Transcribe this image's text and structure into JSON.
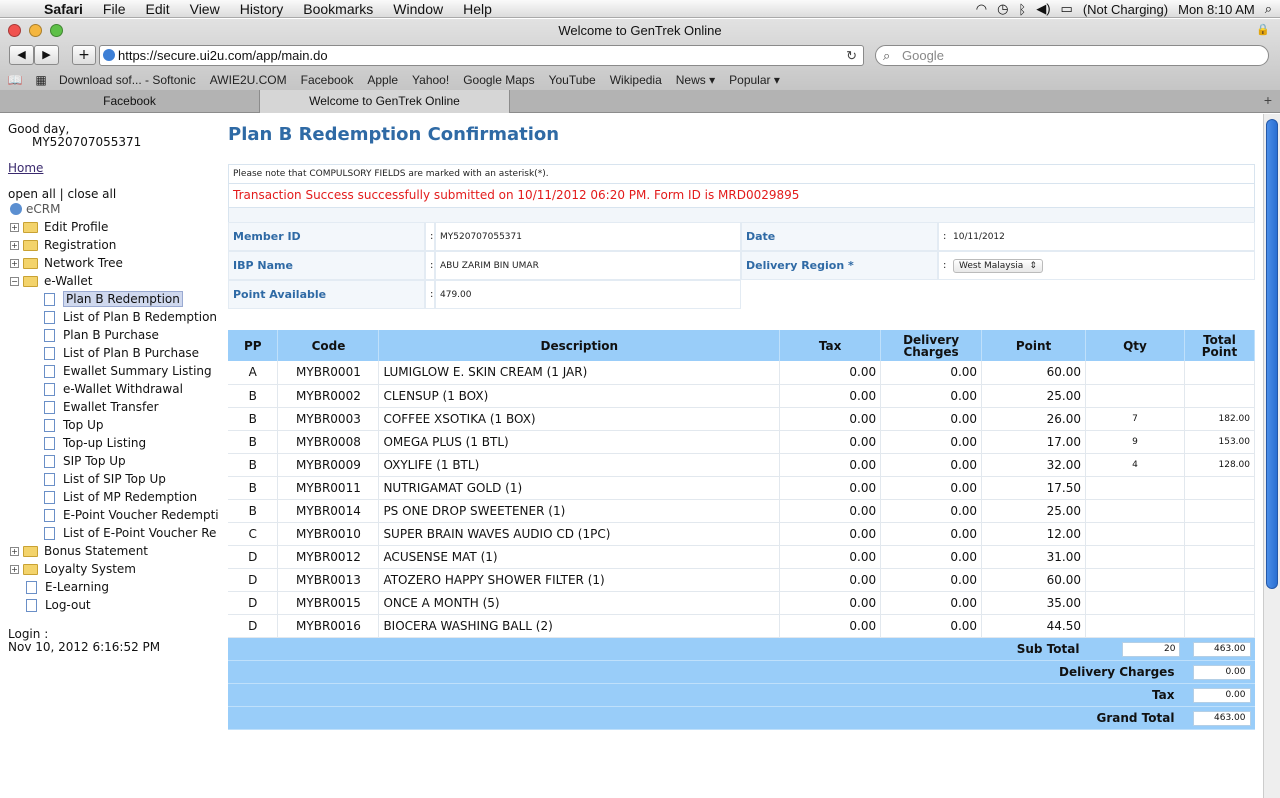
{
  "menubar": {
    "app": "Safari",
    "items": [
      "File",
      "Edit",
      "View",
      "History",
      "Bookmarks",
      "Window",
      "Help"
    ],
    "battery": "(Not Charging)",
    "clock": "Mon 8:10 AM"
  },
  "window": {
    "title": "Welcome to GenTrek Online"
  },
  "toolbar": {
    "url": "https://secure.ui2u.com/app/main.do",
    "search_placeholder": "Google"
  },
  "bookmarks": [
    "Download sof... - Softonic",
    "AWIE2U.COM",
    "Facebook",
    "Apple",
    "Yahoo!",
    "Google Maps",
    "YouTube",
    "Wikipedia",
    "News ▾",
    "Popular ▾"
  ],
  "tabs": [
    {
      "label": "Facebook"
    },
    {
      "label": "Welcome to GenTrek Online"
    }
  ],
  "sidebar": {
    "greeting": "Good day,",
    "user_id": "MY520707055371",
    "home": "Home",
    "open_close": "open all | close all",
    "root": "eCRM",
    "nodes": [
      {
        "label": "Edit Profile",
        "type": "folder"
      },
      {
        "label": "Registration",
        "type": "folder"
      },
      {
        "label": "Network Tree",
        "type": "folder"
      },
      {
        "label": "e-Wallet",
        "type": "folder-open"
      },
      {
        "label": "Plan B Redemption",
        "type": "page",
        "selected": true
      },
      {
        "label": "List of Plan B Redemption",
        "type": "page"
      },
      {
        "label": "Plan B Purchase",
        "type": "page"
      },
      {
        "label": "List of Plan B Purchase",
        "type": "page"
      },
      {
        "label": "Ewallet Summary Listing",
        "type": "page"
      },
      {
        "label": "e-Wallet Withdrawal",
        "type": "page"
      },
      {
        "label": "Ewallet Transfer",
        "type": "page"
      },
      {
        "label": "Top Up",
        "type": "page"
      },
      {
        "label": "Top-up Listing",
        "type": "page"
      },
      {
        "label": "SIP Top Up",
        "type": "page"
      },
      {
        "label": "List of SIP Top Up",
        "type": "page"
      },
      {
        "label": "List of MP Redemption",
        "type": "page"
      },
      {
        "label": "E-Point Voucher Redempti",
        "type": "page"
      },
      {
        "label": "List of E-Point Voucher Re",
        "type": "page"
      },
      {
        "label": "Bonus Statement",
        "type": "folder"
      },
      {
        "label": "Loyalty System",
        "type": "folder"
      },
      {
        "label": "E-Learning",
        "type": "page-root"
      },
      {
        "label": "Log-out",
        "type": "page-root"
      }
    ],
    "login_label": "Login :",
    "login_time": "Nov 10, 2012 6:16:52 PM"
  },
  "main": {
    "title": "Plan B Redemption Confirmation",
    "note": "Please note that COMPULSORY FIELDS are marked with an asterisk(*).",
    "success": "Transaction Success successfully submitted on 10/11/2012 06:20 PM. Form ID is MRD0029895",
    "info": {
      "member_id_label": "Member ID",
      "member_id": "MY520707055371",
      "date_label": "Date",
      "date": "10/11/2012",
      "ibp_label": "IBP Name",
      "ibp": "ABU ZARIM BIN UMAR",
      "region_label": "Delivery Region *",
      "region": "West Malaysia",
      "points_label": "Point Available",
      "points": "479.00",
      "colon": ":"
    },
    "table": {
      "headers": [
        "PP",
        "Code",
        "Description",
        "Tax",
        "Delivery Charges",
        "Point",
        "Qty",
        "Total Point"
      ],
      "rows": [
        [
          "A",
          "MYBR0001",
          "LUMIGLOW E. SKIN CREAM (1 JAR)",
          "0.00",
          "0.00",
          "60.00",
          "",
          ""
        ],
        [
          "B",
          "MYBR0002",
          "CLENSUP (1 BOX)",
          "0.00",
          "0.00",
          "25.00",
          "",
          ""
        ],
        [
          "B",
          "MYBR0003",
          "COFFEE XSOTIKA (1 BOX)",
          "0.00",
          "0.00",
          "26.00",
          "7",
          "182.00"
        ],
        [
          "B",
          "MYBR0008",
          "OMEGA PLUS (1 BTL)",
          "0.00",
          "0.00",
          "17.00",
          "9",
          "153.00"
        ],
        [
          "B",
          "MYBR0009",
          "OXYLIFE (1 BTL)",
          "0.00",
          "0.00",
          "32.00",
          "4",
          "128.00"
        ],
        [
          "B",
          "MYBR0011",
          "NUTRIGAMAT GOLD (1)",
          "0.00",
          "0.00",
          "17.50",
          "",
          ""
        ],
        [
          "B",
          "MYBR0014",
          "PS ONE DROP SWEETENER (1)",
          "0.00",
          "0.00",
          "25.00",
          "",
          ""
        ],
        [
          "C",
          "MYBR0010",
          "SUPER BRAIN WAVES AUDIO CD (1PC)",
          "0.00",
          "0.00",
          "12.00",
          "",
          ""
        ],
        [
          "D",
          "MYBR0012",
          "ACUSENSE MAT (1)",
          "0.00",
          "0.00",
          "31.00",
          "",
          ""
        ],
        [
          "D",
          "MYBR0013",
          "ATOZERO HAPPY SHOWER FILTER (1)",
          "0.00",
          "0.00",
          "60.00",
          "",
          ""
        ],
        [
          "D",
          "MYBR0015",
          "ONCE A MONTH (5)",
          "0.00",
          "0.00",
          "35.00",
          "",
          ""
        ],
        [
          "D",
          "MYBR0016",
          "BIOCERA WASHING BALL (2)",
          "0.00",
          "0.00",
          "44.50",
          "",
          ""
        ]
      ],
      "footer": {
        "subtotal_label": "Sub Total",
        "subtotal_qty": "20",
        "subtotal": "463.00",
        "delivery_label": "Delivery Charges",
        "delivery": "0.00",
        "tax_label": "Tax",
        "tax": "0.00",
        "grand_label": "Grand Total",
        "grand": "463.00"
      }
    }
  }
}
